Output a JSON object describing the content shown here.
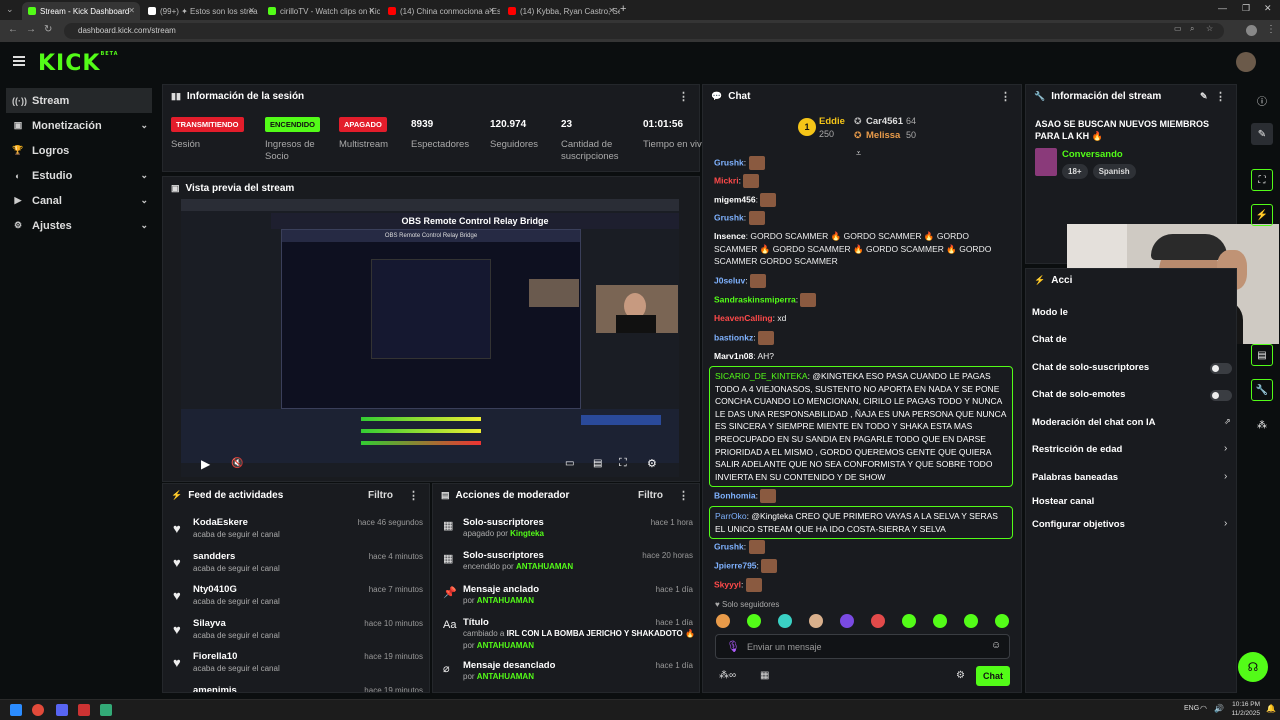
{
  "browser": {
    "tabs": [
      {
        "title": "Stream - Kick Dashboard",
        "color": "#53fc18",
        "active": true
      },
      {
        "title": "(99+) ✦ Estos son los strea",
        "color": "#ffffff",
        "active": false
      },
      {
        "title": "cirilloTV - Watch clips on Kick",
        "color": "#53fc18",
        "active": false
      },
      {
        "title": "(14) China conmociona a Estad",
        "color": "#ff0000",
        "active": false
      },
      {
        "title": "(14) Kybba, Ryan Castro, Sean P",
        "color": "#ff0000",
        "active": false
      }
    ],
    "url": "dashboard.kick.com/stream"
  },
  "brand": {
    "logo": "KICK",
    "beta": "BETA",
    "accent": "#53fc18"
  },
  "sidebar": {
    "items": [
      {
        "label": "Stream",
        "icon": "broadcast-icon",
        "glyph": "((·))",
        "chevron": ""
      },
      {
        "label": "Monetización",
        "icon": "money-icon",
        "glyph": "▣",
        "chevron": "⌄"
      },
      {
        "label": "Logros",
        "icon": "trophy-icon",
        "glyph": "🏆",
        "chevron": ""
      },
      {
        "label": "Estudio",
        "icon": "studio-icon",
        "glyph": "◐",
        "chevron": "⌄"
      },
      {
        "label": "Canal",
        "icon": "channel-icon",
        "glyph": "▶",
        "chevron": "⌄"
      },
      {
        "label": "Ajustes",
        "icon": "settings-icon",
        "glyph": "⚙",
        "chevron": "⌄"
      }
    ]
  },
  "session": {
    "title": "Información de la sesión",
    "stats": [
      {
        "value": "TRANSMITIENDO",
        "label": "Sesión",
        "badge": "red"
      },
      {
        "value": "ENCENDIDO",
        "label": "Ingresos de Socio",
        "badge": "green"
      },
      {
        "value": "APAGADO",
        "label": "Multistream",
        "badge": "red"
      },
      {
        "value": "8939",
        "label": "Espectadores",
        "badge": ""
      },
      {
        "value": "120.974",
        "label": "Seguidores",
        "badge": ""
      },
      {
        "value": "23",
        "label": "Cantidad de suscripciones",
        "badge": ""
      },
      {
        "value": "01:01:56",
        "label": "Tiempo en vivo",
        "badge": ""
      }
    ]
  },
  "preview": {
    "title": "Vista previa del stream",
    "obs_title": "OBS Remote Control Relay Bridge",
    "obs_inner_title": "OBS Remote Control Relay Bridge"
  },
  "feed": {
    "title": "Feed de actividades",
    "filter": "Filtro",
    "items": [
      {
        "name": "KodaEskere",
        "action": "acaba de seguir el canal",
        "time": "hace 46 segundos"
      },
      {
        "name": "sandders",
        "action": "acaba de seguir el canal",
        "time": "hace 4 minutos"
      },
      {
        "name": "Nty0410G",
        "action": "acaba de seguir el canal",
        "time": "hace 7 minutos"
      },
      {
        "name": "Silayva",
        "action": "acaba de seguir el canal",
        "time": "hace 10 minutos"
      },
      {
        "name": "Fiorella10",
        "action": "acaba de seguir el canal",
        "time": "hace 19 minutos"
      },
      {
        "name": "amenimis",
        "action": "",
        "time": "hace 19 minutos"
      }
    ]
  },
  "mod": {
    "title": "Acciones de moderador",
    "filter": "Filtro",
    "items": [
      {
        "icon": "gift-icon",
        "glyph": "▦",
        "name": "Solo-suscriptores",
        "sub_pre": "apagado por ",
        "sub_user": "Kingteka",
        "sub2_pre": "",
        "sub2_user": "",
        "time": "hace 1 hora"
      },
      {
        "icon": "gift-icon",
        "glyph": "▦",
        "name": "Solo-suscriptores",
        "sub_pre": "encendido por ",
        "sub_user": "ANTAHUAMAN",
        "sub2_pre": "",
        "sub2_user": "",
        "time": "hace 20 horas"
      },
      {
        "icon": "pin-icon",
        "glyph": "📌",
        "name": "Mensaje anclado",
        "sub_pre": "por ",
        "sub_user": "ANTAHUAMAN",
        "sub2_pre": "",
        "sub2_user": "",
        "time": "hace 1 día"
      },
      {
        "icon": "title-icon",
        "glyph": "Aa",
        "name": "Título",
        "sub_pre": "cambiado a ",
        "sub_user": "IRL CON LA BOMBA JERICHO Y SHAKADOTO 🔥",
        "sub2_pre": "por ",
        "sub2_user": "ANTAHUAMAN",
        "time": "hace 1 día"
      },
      {
        "icon": "unpin-icon",
        "glyph": "⌀",
        "name": "Mensaje desanclado",
        "sub_pre": "por ",
        "sub_user": "ANTAHUAMAN",
        "sub2_pre": "",
        "sub2_user": "",
        "time": "hace 1 día"
      }
    ]
  },
  "chat": {
    "title": "Chat",
    "leaderboard": {
      "first_name": "Eddie",
      "first_count": "250",
      "second_name": "Car4561",
      "second_count": "64",
      "third_name": "Melissa",
      "third_count": "50"
    },
    "messages": [
      {
        "user": "Grushk",
        "color": "#7fb2ff",
        "text": "",
        "emote": true
      },
      {
        "user": "Mickri",
        "color": "#ff4a4a",
        "text": "",
        "emote": true
      },
      {
        "user": "migem456",
        "color": "#ffffff",
        "text": "",
        "emote": true
      },
      {
        "user": "Grushk",
        "color": "#7fb2ff",
        "text": "",
        "emote": true
      },
      {
        "user": "Insence",
        "color": "#ffffff",
        "text": "GORDO SCAMMER 🔥 GORDO SCAMMER 🔥 GORDO SCAMMER 🔥 GORDO SCAMMER 🔥 GORDO SCAMMER 🔥 GORDO SCAMMER GORDO SCAMMER",
        "emote": false
      },
      {
        "user": "J0seluv",
        "color": "#7fb2ff",
        "text": "",
        "emote": true
      },
      {
        "user": "Sandraskinsmiperra",
        "color": "#53fc18",
        "text": "",
        "emote": true
      },
      {
        "user": "HeavenCalling",
        "color": "#ff4a4a",
        "text": "xd",
        "emote": false
      },
      {
        "user": "bastionkz",
        "color": "#7fb2ff",
        "text": "",
        "emote": true
      },
      {
        "user": "Marv1n08",
        "color": "#ffffff",
        "text": "AH?",
        "emote": false
      }
    ],
    "highlight1_user": "SICARIO_DE_KINTEKA",
    "highlight1_text": "@KINGTEKA ESO PASA CUANDO LE PAGAS TODO A 4 VIEJONASOS, SUSTENTO NO APORTA EN NADA Y SE PONE CONCHA CUANDO LO MENCIONAN, CIRILO LE PAGAS TODO Y NUNCA LE DAS UNA RESPONSABILIDAD , ÑAJA ES UNA PERSONA QUE NUNCA ES SINCERA Y SIEMPRE MIENTE EN TODO Y SHAKA ESTA MAS PREOCUPADO EN SU SANDIA EN PAGARLE TODO QUE EN DARSE PRIORIDAD A EL MISMO , GORDO QUEREMOS GENTE QUE QUIERA SALIR ADELANTE QUE NO SEA CONFORMISTA Y QUE SOBRE TODO INVIERTA EN SU CONTENIDO Y DE SHOW",
    "after1_user": "Bonhomia",
    "highlight2_user": "ParrOko",
    "highlight2_text": "@Kingteka CREO QUE PRIMERO VAYAS A LA SELVA Y SERAS EL UNICO STREAM QUE HA IDO COSTA-SIERRA Y SELVA",
    "tail": [
      {
        "user": "Grushk",
        "color": "#7fb2ff"
      },
      {
        "user": "Jpierre795",
        "color": "#7fb2ff"
      },
      {
        "user": "Skyyyl",
        "color": "#ff4a4a"
      }
    ],
    "followers_only": "Solo seguidores",
    "input_placeholder": "Enviar un mensaje",
    "send_label": "Chat"
  },
  "stream_info": {
    "title": "Información del stream",
    "stream_title": "ASAO SE BUSCAN NUEVOS MIEMBROS PARA LA KH 🔥",
    "category": "Conversando",
    "tags": [
      "18+",
      "Spanish"
    ]
  },
  "actions": {
    "title": "Acci",
    "items": [
      {
        "label": "Modo le",
        "control": "none"
      },
      {
        "label": "Chat de",
        "control": "none"
      },
      {
        "label": "Chat de solo-suscriptores",
        "control": "toggle"
      },
      {
        "label": "Chat de solo-emotes",
        "control": "toggle"
      },
      {
        "label": "Moderación del chat con IA",
        "control": "external"
      },
      {
        "label": "Restricción de edad",
        "control": "chevron"
      },
      {
        "label": "Palabras baneadas",
        "control": "chevron"
      },
      {
        "label": "Hostear canal",
        "control": "none"
      },
      {
        "label": "Configurar objetivos",
        "control": "chevron"
      }
    ]
  },
  "taskbar": {
    "lang": "ENG",
    "time": "10:16 PM",
    "date": "11/2/2025"
  }
}
